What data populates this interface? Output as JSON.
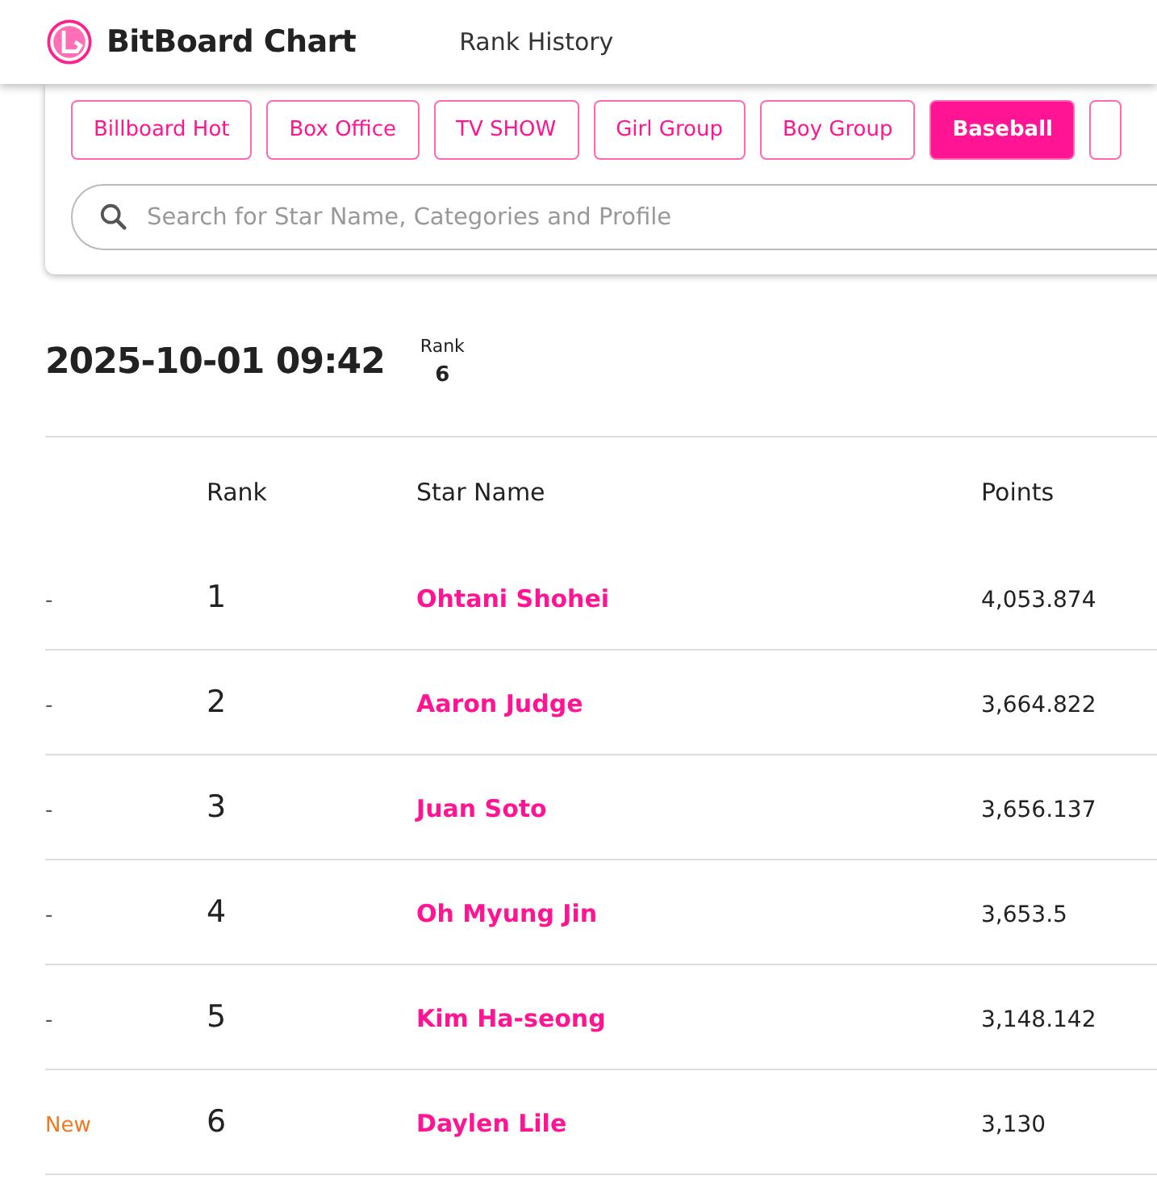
{
  "header": {
    "brand": "BitBoard Chart",
    "nav": [
      "Rank History"
    ]
  },
  "tabs": [
    {
      "label": "Billboard Hot",
      "selected": false
    },
    {
      "label": "Box Office",
      "selected": false
    },
    {
      "label": "TV SHOW",
      "selected": false
    },
    {
      "label": "Girl Group",
      "selected": false
    },
    {
      "label": "Boy Group",
      "selected": false
    },
    {
      "label": "Baseball",
      "selected": true
    }
  ],
  "search": {
    "placeholder": "Search for Star Name, Categories and Profile"
  },
  "snapshot": {
    "datetime": "2025-10-01 09:42",
    "rank_label": "Rank",
    "rank": "6"
  },
  "table": {
    "columns": [
      "",
      "Rank",
      "Star Name",
      "Points"
    ],
    "rows": [
      {
        "change": "-",
        "kind": "same",
        "rank": "1",
        "name": "Ohtani Shohei",
        "points": "4,053.874"
      },
      {
        "change": "-",
        "kind": "same",
        "rank": "2",
        "name": "Aaron Judge",
        "points": "3,664.822"
      },
      {
        "change": "-",
        "kind": "same",
        "rank": "3",
        "name": "Juan Soto",
        "points": "3,656.137"
      },
      {
        "change": "-",
        "kind": "same",
        "rank": "4",
        "name": "Oh Myung Jin",
        "points": "3,653.5"
      },
      {
        "change": "-",
        "kind": "same",
        "rank": "5",
        "name": "Kim Ha-seong",
        "points": "3,148.142"
      },
      {
        "change": "New",
        "kind": "new",
        "rank": "6",
        "name": "Daylen Lile",
        "points": "3,130"
      }
    ]
  }
}
